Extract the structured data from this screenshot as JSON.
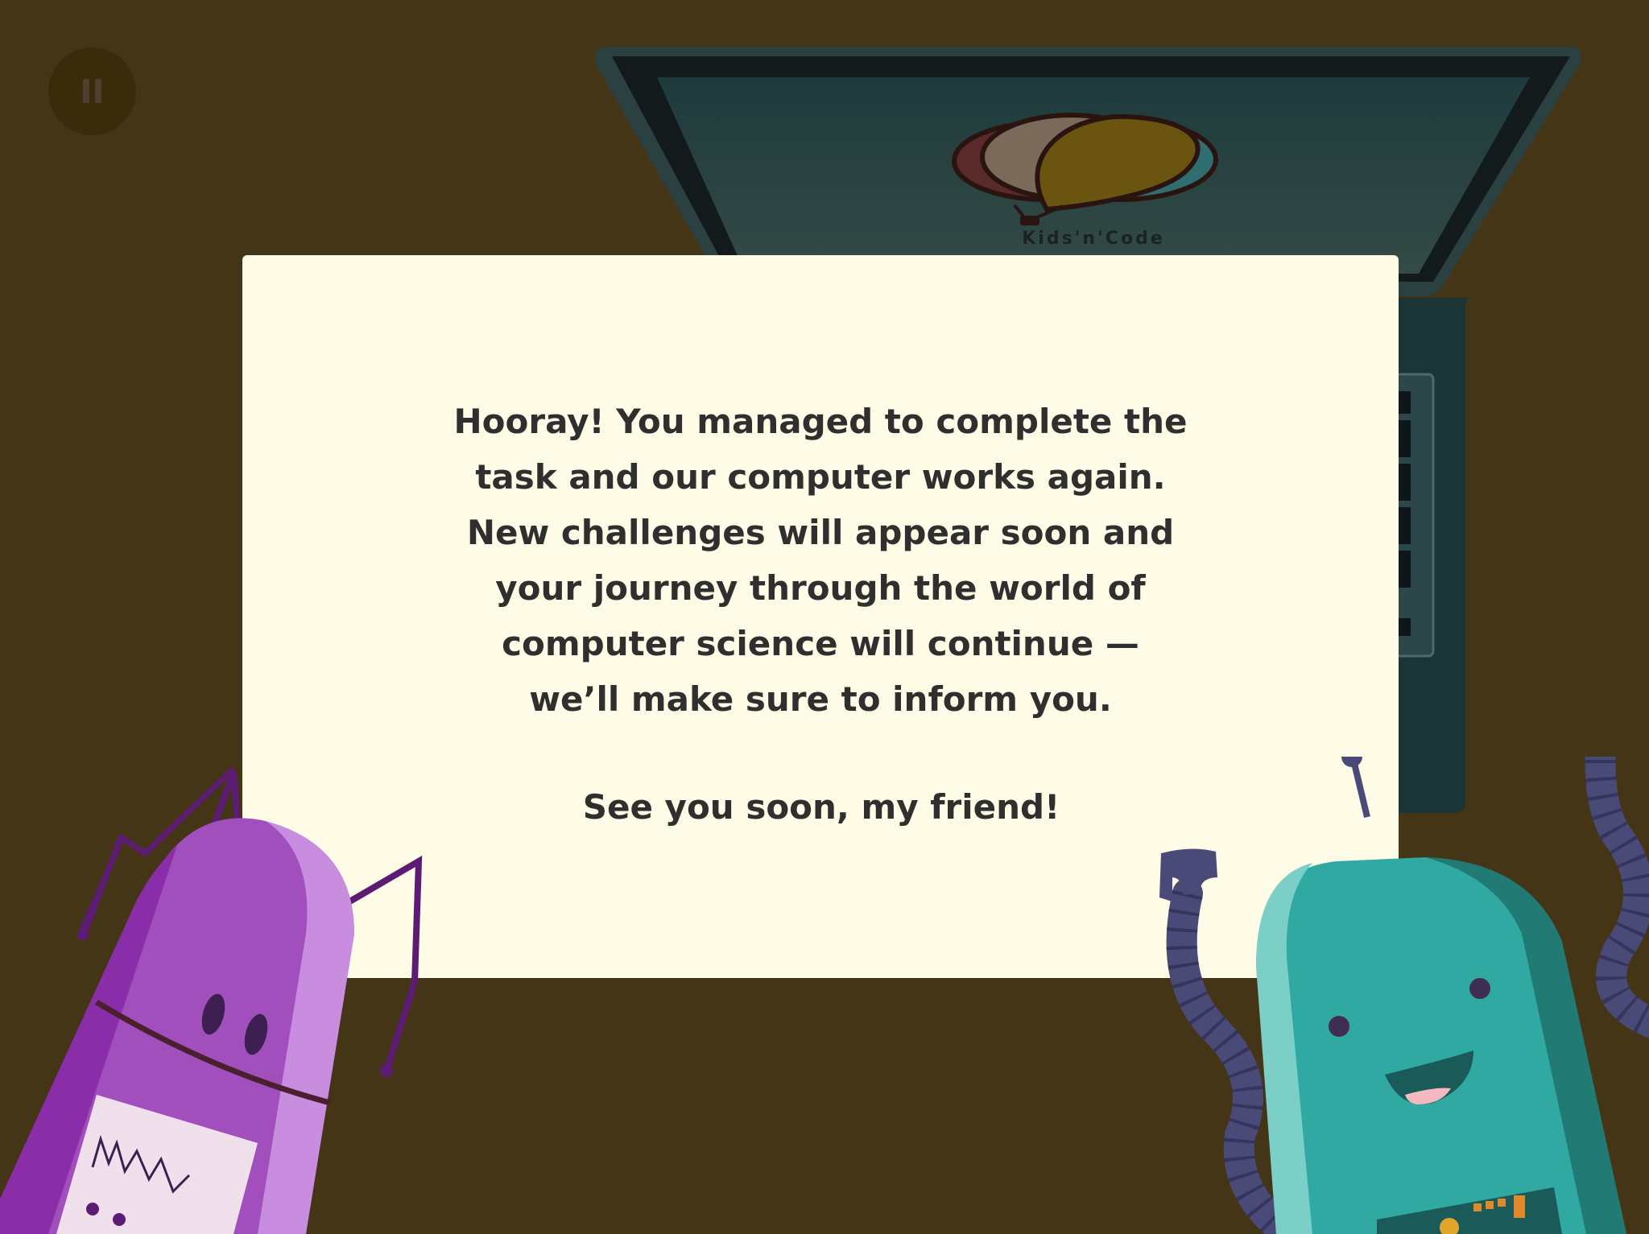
{
  "pause": {
    "icon": "pause-icon",
    "label": "Pause"
  },
  "laptop": {
    "screen_logo_text": "Kids'n'Code",
    "logo_icon": "hot-air-balloon-icon"
  },
  "dialog": {
    "message": "Hooray! You managed to complete the\ntask and our computer works again.\nNew challenges will appear soon and\nyour journey through the world  of\ncomputer science will continue —\nwe’ll make sure to inform you.",
    "closing": "See you soon, my friend!"
  },
  "characters": {
    "left": "purple-robot",
    "right": "teal-robot"
  },
  "colors": {
    "background": "#443516",
    "dialog": "#fefce6",
    "text": "#2f2f30",
    "pause_button": "#3a2b0b",
    "laptop_body": "#1b3436",
    "robot_purple": "#a24fbe",
    "robot_teal": "#2fa9a2",
    "robot_arms": "#4a4a78"
  }
}
